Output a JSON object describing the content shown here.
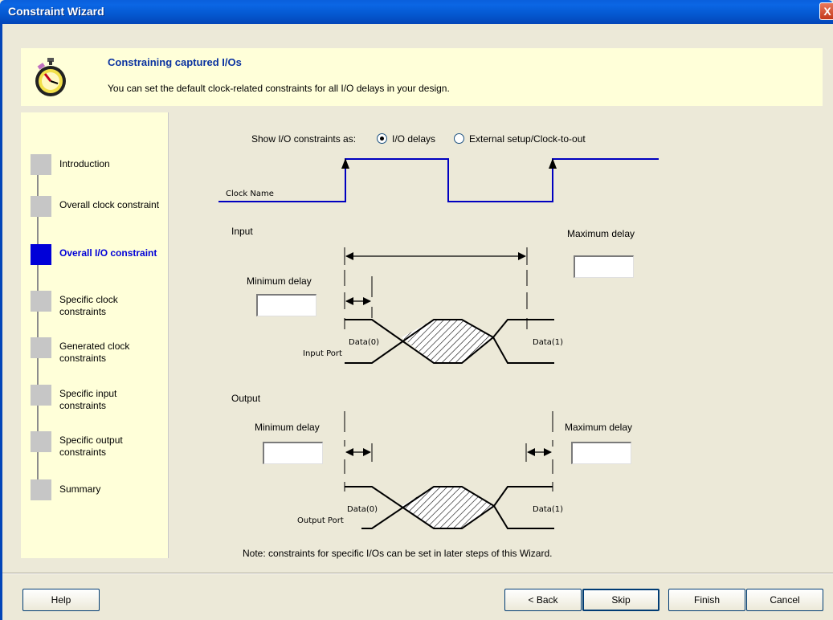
{
  "window": {
    "title": "Constraint Wizard",
    "close_label": "X"
  },
  "header": {
    "heading": "Constraining captured I/Os",
    "description": "You can set the default clock-related constraints for all I/O delays in your design."
  },
  "steps": [
    {
      "label": "Introduction",
      "active": false
    },
    {
      "label": "Overall clock constraint",
      "active": false
    },
    {
      "label": "Overall I/O constraint",
      "active": true
    },
    {
      "label": "Specific clock constraints",
      "active": false
    },
    {
      "label": "Generated clock constraints",
      "active": false
    },
    {
      "label": "Specific input constraints",
      "active": false
    },
    {
      "label": "Specific output constraints",
      "active": false
    },
    {
      "label": "Summary",
      "active": false
    }
  ],
  "options": {
    "prompt": "Show I/O constraints as:",
    "io_delays": {
      "label": "I/O delays",
      "selected": true
    },
    "external": {
      "label": "External setup/Clock-to-out",
      "selected": false
    }
  },
  "diagram": {
    "clock_name": "Clock Name",
    "input_section": "Input",
    "output_section": "Output",
    "input": {
      "min_label": "Minimum delay",
      "min_value": "",
      "max_label": "Maximum delay",
      "max_value": "",
      "data0": "Data(0)",
      "data1": "Data(1)",
      "port": "Input Port"
    },
    "output": {
      "min_label": "Minimum delay",
      "min_value": "",
      "max_label": "Maximum delay",
      "max_value": "",
      "data0": "Data(0)",
      "data1": "Data(1)",
      "port": "Output Port"
    }
  },
  "note": "Note: constraints for specific I/Os can be set in later steps of this Wizard.",
  "buttons": {
    "help": "Help",
    "back": "< Back",
    "skip": "Skip",
    "finish": "Finish",
    "cancel": "Cancel"
  },
  "colors": {
    "clock_wave": "#0000c0",
    "header_bg": "#ffffd9",
    "active_step": "#0000d8",
    "title_bar": "#0458d0"
  }
}
